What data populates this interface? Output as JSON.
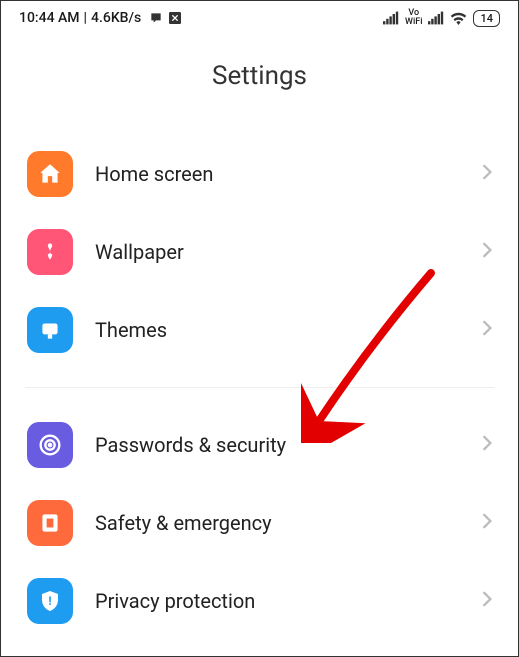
{
  "statusBar": {
    "time": "10:44 AM",
    "speed": "4.6KB/s",
    "voWifi": "Vo WiFi",
    "battery": "14"
  },
  "title": "Settings",
  "group1": [
    {
      "label": "Home screen",
      "iconName": "home-icon",
      "iconBg": "#ff7a2b"
    },
    {
      "label": "Wallpaper",
      "iconName": "wallpaper-icon",
      "iconBg": "#ff5577"
    },
    {
      "label": "Themes",
      "iconName": "themes-icon",
      "iconBg": "#1e9cf0"
    }
  ],
  "group2": [
    {
      "label": "Passwords & security",
      "iconName": "security-icon",
      "iconBg": "#6a5ce0"
    },
    {
      "label": "Safety & emergency",
      "iconName": "safety-icon",
      "iconBg": "#ff6a3d"
    },
    {
      "label": "Privacy protection",
      "iconName": "privacy-icon",
      "iconBg": "#1e9cf0"
    }
  ]
}
